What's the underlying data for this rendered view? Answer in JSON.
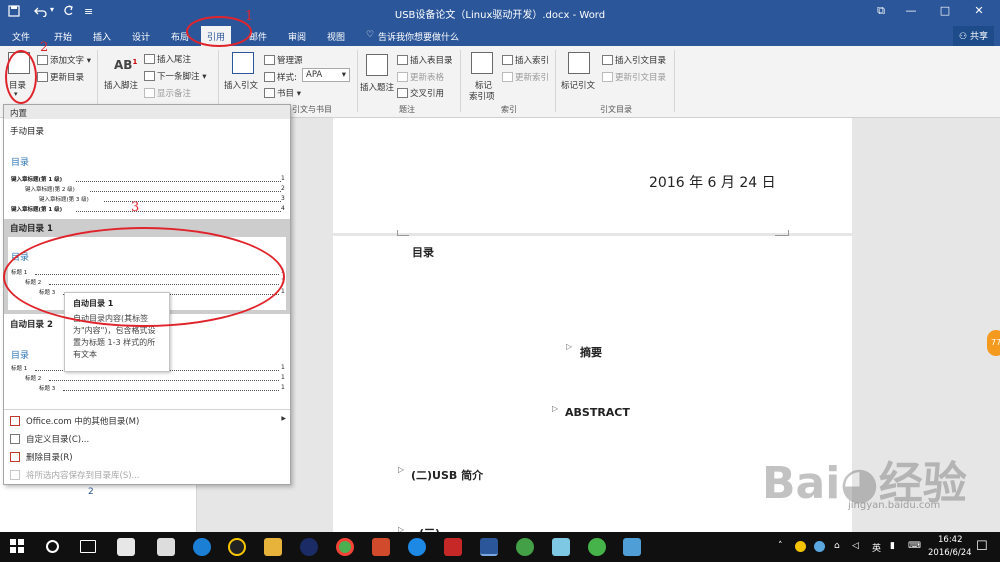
{
  "titlebar": {
    "title": "USB设备论文（Linux驱动开发）.docx - Word",
    "save_icon": "save-icon",
    "undo_icon": "undo-icon",
    "redo_icon": "redo-icon",
    "qa_more": "≡",
    "restore_glyph": "⧉",
    "min_glyph": "—",
    "max_glyph": "□",
    "close_glyph": "✕"
  },
  "tabs": [
    "文件",
    "开始",
    "插入",
    "设计",
    "布局",
    "引用",
    "邮件",
    "审阅",
    "视图"
  ],
  "active_tab": "引用",
  "tell_me": "告诉我你想要做什么",
  "share": "共享",
  "ribbon": {
    "toc_button": "目录",
    "add_text": "添加文字",
    "update_toc": "更新目录",
    "insert_footnote": "插入脚注",
    "insert_endnote": "插入尾注",
    "next_footnote": "下一条脚注",
    "show_notes": "显示备注",
    "ab_label": "AB",
    "ab_sup": "1",
    "insert_citation": "插入引文",
    "manage_sources": "管理源",
    "style_label": "样式:",
    "style_value": "APA",
    "bibliography": "书目",
    "citations_group": "引文与书目",
    "insert_caption": "插入题注",
    "insert_table_of_figures": "插入表目录",
    "update_table": "更新表格",
    "cross_reference": "交叉引用",
    "captions_group": "题注",
    "mark_entry": "标记",
    "mark_entry2": "索引项",
    "insert_index": "插入索引",
    "update_index": "更新索引",
    "index_group": "索引",
    "mark_citation": "标记引文",
    "insert_toa": "插入引文目录",
    "update_toa": "更新引文目录",
    "toa_group": "引文目录"
  },
  "gallery": {
    "section_header": "内置",
    "manual_title": "手动目录",
    "manual_preview_title": "目录",
    "manual_lines": [
      {
        "text": "键入章标题(第 1 级)",
        "page": "1"
      },
      {
        "text": "键入章标题(第 2 级)",
        "page": "2"
      },
      {
        "text": "键入章标题(第 3 级)",
        "page": "3"
      },
      {
        "text": "键入章标题(第 1 级)",
        "page": "4"
      }
    ],
    "auto1_title": "自动目录 1",
    "auto1_preview_title": "目录",
    "auto1_lines": [
      {
        "text": "标题 1",
        "page": "1"
      },
      {
        "text": "标题 2",
        "page": "1"
      },
      {
        "text": "标题 3",
        "page": "1"
      }
    ],
    "auto2_title": "自动目录 2",
    "auto2_preview_title": "目录",
    "auto2_lines": [
      {
        "text": "标题 1",
        "page": "1"
      },
      {
        "text": "标题 2",
        "page": "1"
      },
      {
        "text": "标题 3",
        "page": "1"
      }
    ],
    "menu": [
      {
        "label": "Office.com 中的其他目录(M)",
        "enabled": true,
        "submenu": true
      },
      {
        "label": "自定义目录(C)...",
        "enabled": true,
        "submenu": false
      },
      {
        "label": "删除目录(R)",
        "enabled": true,
        "submenu": false
      },
      {
        "label": "将所选内容保存到目录库(S)...",
        "enabled": false,
        "submenu": false
      }
    ],
    "submenu_arrow": "▶"
  },
  "tooltip": {
    "title": "自动目录 1",
    "body": "自动目录内容(其标签为\"内容\")，包含格式设置为标题 1-3 样式的所有文本"
  },
  "document": {
    "date": "2016 年 6 月 24 日",
    "toc_heading": "目录",
    "headings": [
      "摘要",
      "ABSTRACT",
      "(二)USB 简介",
      "(三)"
    ],
    "collapse_glyph": "▷",
    "page_number": "2"
  },
  "annotations": [
    "1",
    "2",
    "3"
  ],
  "side_badge": "77",
  "taskbar": {
    "tray_lang": "英",
    "tray_up": "˄",
    "time": "16:42",
    "date": "2016/6/24"
  },
  "watermark": {
    "brand": "Bai◕经验",
    "url": "jingyan.baidu.com"
  },
  "colors": {
    "accent": "#2b579a",
    "annotation": "#e0242c",
    "heading_blue": "#2e74b5",
    "taskbar": "#101010"
  }
}
